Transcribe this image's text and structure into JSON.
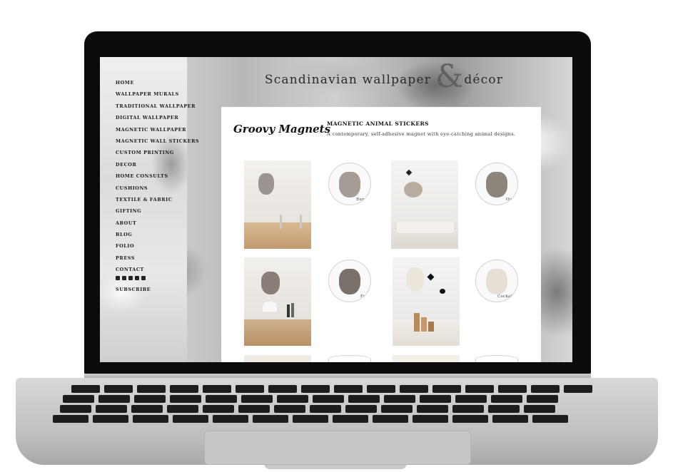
{
  "site": {
    "title": "Scandinavian wallpaper",
    "title_tail": "décor",
    "ampersand": "&"
  },
  "nav": {
    "items": [
      "HOME",
      "WALLPAPER MURALS",
      "TRADITIONAL WALLPAPER",
      "DIGITAL WALLPAPER",
      "MAGNETIC WALLPAPER",
      "MAGNETIC WALL STICKERS",
      "CUSTOM PRINTING",
      "DECOR",
      "HOME CONSULTS",
      "CUSHIONS",
      "TEXTILE & FABRIC",
      "GIFTING",
      "ABOUT",
      "BLOG",
      "FOLIO",
      "PRESS",
      "CONTACT"
    ],
    "social_icons": [
      "facebook-icon",
      "pinterest-icon",
      "twitter-icon",
      "instagram-icon",
      "houzz-icon"
    ],
    "subscribe": "SUBSCRIBE"
  },
  "article": {
    "brand": "Groovy Magnets",
    "title": "MAGNETIC ANIMAL STICKERS",
    "description": "A contemporary, self-adhesive magnet with eye-catching animal designs."
  },
  "products": [
    {
      "caption": "Bunny"
    },
    {
      "caption": "Owl"
    },
    {
      "caption": "Fox"
    },
    {
      "caption": "Cockatiel"
    }
  ],
  "colors": {
    "bezel": "#0b0b0b",
    "laptop_silver": "#c4c4c4",
    "text_dark": "#1b1b1b"
  }
}
